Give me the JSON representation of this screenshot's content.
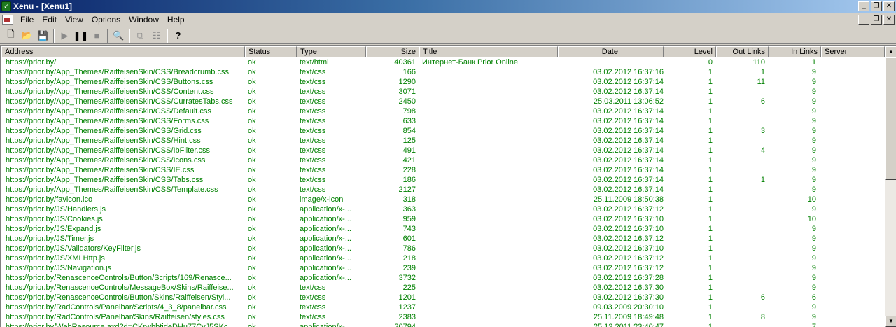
{
  "window": {
    "title": "Xenu - [Xenu1]",
    "minimize_glyph": "_",
    "restore_glyph": "❐",
    "close_glyph": "✕"
  },
  "menu": {
    "items": [
      "File",
      "Edit",
      "View",
      "Options",
      "Window",
      "Help"
    ]
  },
  "toolbar": {
    "icons": [
      "new-file-icon",
      "open-folder-icon",
      "save-icon",
      "play-icon",
      "pause-icon",
      "stop-icon",
      "find-icon",
      "copy-icon",
      "properties-icon",
      "help-icon"
    ]
  },
  "table": {
    "columns": [
      "Address",
      "Status",
      "Type",
      "Size",
      "Title",
      "Date",
      "Level",
      "Out Links",
      "In Links",
      "Server"
    ],
    "rows": [
      {
        "address": "https://prior.by/",
        "status": "ok",
        "type": "text/html",
        "size": "40361",
        "title": "Интернет-Банк Prior Online",
        "date": "",
        "level": "0",
        "out": "110",
        "in": "1",
        "server": ""
      },
      {
        "address": "https://prior.by/App_Themes/RaiffeisenSkin/CSS/Breadcrumb.css",
        "status": "ok",
        "type": "text/css",
        "size": "166",
        "title": "",
        "date": "03.02.2012  16:37:16",
        "level": "1",
        "out": "1",
        "in": "9",
        "server": ""
      },
      {
        "address": "https://prior.by/App_Themes/RaiffeisenSkin/CSS/Buttons.css",
        "status": "ok",
        "type": "text/css",
        "size": "1290",
        "title": "",
        "date": "03.02.2012  16:37:14",
        "level": "1",
        "out": "11",
        "in": "9",
        "server": ""
      },
      {
        "address": "https://prior.by/App_Themes/RaiffeisenSkin/CSS/Content.css",
        "status": "ok",
        "type": "text/css",
        "size": "3071",
        "title": "",
        "date": "03.02.2012  16:37:14",
        "level": "1",
        "out": "",
        "in": "9",
        "server": ""
      },
      {
        "address": "https://prior.by/App_Themes/RaiffeisenSkin/CSS/CurratesTabs.css",
        "status": "ok",
        "type": "text/css",
        "size": "2450",
        "title": "",
        "date": "25.03.2011  13:06:52",
        "level": "1",
        "out": "6",
        "in": "9",
        "server": ""
      },
      {
        "address": "https://prior.by/App_Themes/RaiffeisenSkin/CSS/Default.css",
        "status": "ok",
        "type": "text/css",
        "size": "798",
        "title": "",
        "date": "03.02.2012  16:37:14",
        "level": "1",
        "out": "",
        "in": "9",
        "server": ""
      },
      {
        "address": "https://prior.by/App_Themes/RaiffeisenSkin/CSS/Forms.css",
        "status": "ok",
        "type": "text/css",
        "size": "633",
        "title": "",
        "date": "03.02.2012  16:37:14",
        "level": "1",
        "out": "",
        "in": "9",
        "server": ""
      },
      {
        "address": "https://prior.by/App_Themes/RaiffeisenSkin/CSS/Grid.css",
        "status": "ok",
        "type": "text/css",
        "size": "854",
        "title": "",
        "date": "03.02.2012  16:37:14",
        "level": "1",
        "out": "3",
        "in": "9",
        "server": ""
      },
      {
        "address": "https://prior.by/App_Themes/RaiffeisenSkin/CSS/Hint.css",
        "status": "ok",
        "type": "text/css",
        "size": "125",
        "title": "",
        "date": "03.02.2012  16:37:14",
        "level": "1",
        "out": "",
        "in": "9",
        "server": ""
      },
      {
        "address": "https://prior.by/App_Themes/RaiffeisenSkin/CSS/IbFilter.css",
        "status": "ok",
        "type": "text/css",
        "size": "491",
        "title": "",
        "date": "03.02.2012  16:37:14",
        "level": "1",
        "out": "4",
        "in": "9",
        "server": ""
      },
      {
        "address": "https://prior.by/App_Themes/RaiffeisenSkin/CSS/Icons.css",
        "status": "ok",
        "type": "text/css",
        "size": "421",
        "title": "",
        "date": "03.02.2012  16:37:14",
        "level": "1",
        "out": "",
        "in": "9",
        "server": ""
      },
      {
        "address": "https://prior.by/App_Themes/RaiffeisenSkin/CSS/IE.css",
        "status": "ok",
        "type": "text/css",
        "size": "228",
        "title": "",
        "date": "03.02.2012  16:37:14",
        "level": "1",
        "out": "",
        "in": "9",
        "server": ""
      },
      {
        "address": "https://prior.by/App_Themes/RaiffeisenSkin/CSS/Tabs.css",
        "status": "ok",
        "type": "text/css",
        "size": "186",
        "title": "",
        "date": "03.02.2012  16:37:14",
        "level": "1",
        "out": "1",
        "in": "9",
        "server": ""
      },
      {
        "address": "https://prior.by/App_Themes/RaiffeisenSkin/CSS/Template.css",
        "status": "ok",
        "type": "text/css",
        "size": "2127",
        "title": "",
        "date": "03.02.2012  16:37:14",
        "level": "1",
        "out": "",
        "in": "9",
        "server": ""
      },
      {
        "address": "https://prior.by/favicon.ico",
        "status": "ok",
        "type": "image/x-icon",
        "size": "318",
        "title": "",
        "date": "25.11.2009  18:50:38",
        "level": "1",
        "out": "",
        "in": "10",
        "server": ""
      },
      {
        "address": "https://prior.by/JS/Handlers.js",
        "status": "ok",
        "type": "application/x-...",
        "size": "363",
        "title": "",
        "date": "03.02.2012  16:37:12",
        "level": "1",
        "out": "",
        "in": "9",
        "server": ""
      },
      {
        "address": "https://prior.by/JS/Cookies.js",
        "status": "ok",
        "type": "application/x-...",
        "size": "959",
        "title": "",
        "date": "03.02.2012  16:37:10",
        "level": "1",
        "out": "",
        "in": "10",
        "server": ""
      },
      {
        "address": "https://prior.by/JS/Expand.js",
        "status": "ok",
        "type": "application/x-...",
        "size": "743",
        "title": "",
        "date": "03.02.2012  16:37:10",
        "level": "1",
        "out": "",
        "in": "9",
        "server": ""
      },
      {
        "address": "https://prior.by/JS/Timer.js",
        "status": "ok",
        "type": "application/x-...",
        "size": "601",
        "title": "",
        "date": "03.02.2012  16:37:12",
        "level": "1",
        "out": "",
        "in": "9",
        "server": ""
      },
      {
        "address": "https://prior.by/JS/Validators/KeyFilter.js",
        "status": "ok",
        "type": "application/x-...",
        "size": "786",
        "title": "",
        "date": "03.02.2012  16:37:10",
        "level": "1",
        "out": "",
        "in": "9",
        "server": ""
      },
      {
        "address": "https://prior.by/JS/XMLHttp.js",
        "status": "ok",
        "type": "application/x-...",
        "size": "218",
        "title": "",
        "date": "03.02.2012  16:37:12",
        "level": "1",
        "out": "",
        "in": "9",
        "server": ""
      },
      {
        "address": "https://prior.by/JS/Navigation.js",
        "status": "ok",
        "type": "application/x-...",
        "size": "239",
        "title": "",
        "date": "03.02.2012  16:37:12",
        "level": "1",
        "out": "",
        "in": "9",
        "server": ""
      },
      {
        "address": "https://prior.by/RenascenceControls/Button/Scripts/169/Renasce...",
        "status": "ok",
        "type": "application/x-...",
        "size": "3732",
        "title": "",
        "date": "03.02.2012  16:37:28",
        "level": "1",
        "out": "",
        "in": "9",
        "server": ""
      },
      {
        "address": "https://prior.by/RenascenceControls/MessageBox/Skins/Raiffeise...",
        "status": "ok",
        "type": "text/css",
        "size": "225",
        "title": "",
        "date": "03.02.2012  16:37:30",
        "level": "1",
        "out": "",
        "in": "9",
        "server": ""
      },
      {
        "address": "https://prior.by/RenascenceControls/Button/Skins/Raiffeisen/Styl...",
        "status": "ok",
        "type": "text/css",
        "size": "1201",
        "title": "",
        "date": "03.02.2012  16:37:30",
        "level": "1",
        "out": "6",
        "in": "6",
        "server": ""
      },
      {
        "address": "https://prior.by/RadControls/Panelbar/Scripts/4_3_8/panelbar.css",
        "status": "ok",
        "type": "text/css",
        "size": "1237",
        "title": "",
        "date": "09.03.2009  20:30:10",
        "level": "1",
        "out": "",
        "in": "9",
        "server": ""
      },
      {
        "address": "https://prior.by/RadControls/Panelbar/Skins/Raiffeisen/styles.css",
        "status": "ok",
        "type": "text/css",
        "size": "2383",
        "title": "",
        "date": "25.11.2009  18:49:48",
        "level": "1",
        "out": "8",
        "in": "9",
        "server": ""
      },
      {
        "address": "https://prior.by/WebResource.axd?d=CKrwbbtjdeDHu77CyJ5SKc...",
        "status": "ok",
        "type": "application/x-...",
        "size": "20794",
        "title": "",
        "date": "25.12.2011  23:40:47",
        "level": "1",
        "out": "",
        "in": "7",
        "server": ""
      }
    ]
  },
  "colors": {
    "ok_text": "#008000",
    "titlebar_start": "#0a246a",
    "titlebar_end": "#a6caf0"
  }
}
